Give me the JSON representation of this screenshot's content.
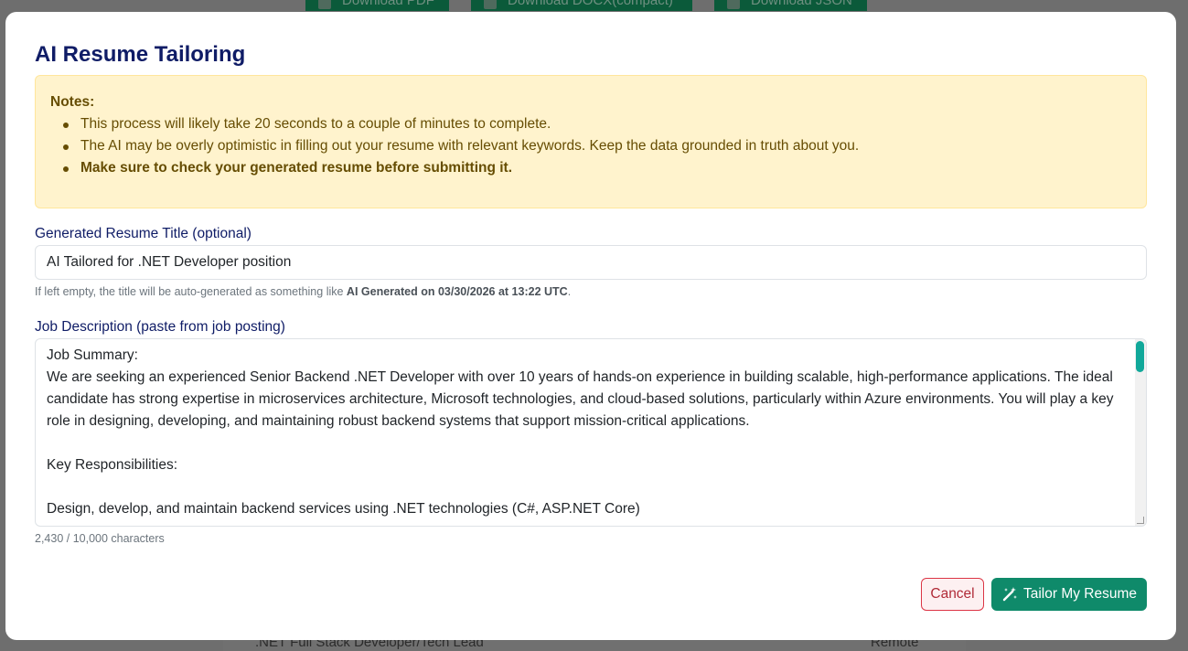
{
  "background": {
    "toolbar": {
      "download_pdf": "Download PDF",
      "download_docx": "Download DOCX(compact)",
      "download_json": "Download JSON"
    },
    "row": {
      "title": ".NET Full Stack Developer/Tech Lead",
      "location": "Remote"
    }
  },
  "modal": {
    "title": "AI Resume Tailoring",
    "notes": {
      "heading": "Notes:",
      "items": [
        "This process will likely take 20 seconds to a couple of minutes to complete.",
        "The AI may be overly optimistic in filling out your resume with relevant keywords. Keep the data grounded in truth about you.",
        "Make sure to check your generated resume before submitting it."
      ]
    },
    "resume_title": {
      "label": "Generated Resume Title (optional)",
      "value": "AI Tailored for .NET Developer position",
      "help_prefix": "If left empty, the title will be auto-generated as something like ",
      "help_bold": "AI Generated on 03/30/2026 at 13:22 UTC",
      "help_suffix": "."
    },
    "job_description": {
      "label": "Job Description (paste from job posting)",
      "value": "Job Summary:\nWe are seeking an experienced Senior Backend .NET Developer with over 10 years of hands-on experience in building scalable, high-performance applications. The ideal candidate has strong expertise in microservices architecture, Microsoft technologies, and cloud-based solutions, particularly within Azure environments. You will play a key role in designing, developing, and maintaining robust backend systems that support mission-critical applications.\n\nKey Responsibilities:\n\nDesign, develop, and maintain backend services using .NET technologies (C#, ASP.NET Core)",
      "char_count": "2,430 / 10,000 characters"
    },
    "buttons": {
      "cancel": "Cancel",
      "tailor": "Tailor My Resume"
    }
  },
  "colors": {
    "accent": "#0f8a6a",
    "title": "#0f1c66",
    "warning_bg": "#fff3cd",
    "scroll_thumb": "#11a89a"
  },
  "icons": {
    "tailor": "magic-wand-icon"
  }
}
